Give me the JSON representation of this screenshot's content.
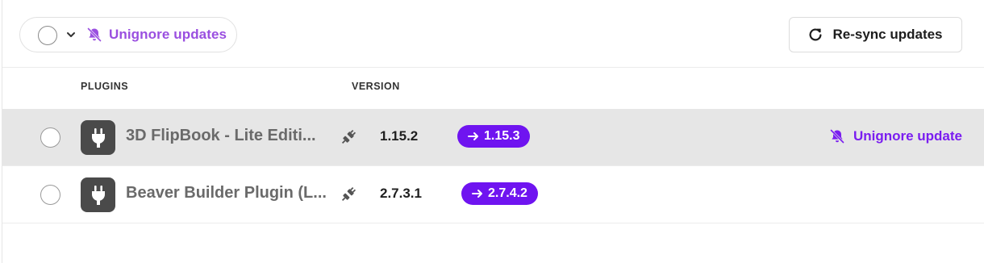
{
  "toolbar": {
    "ignore_label": "Unignore updates",
    "resync_label": "Re-sync updates"
  },
  "headers": {
    "plugins": "PLUGINS",
    "version": "VERSION"
  },
  "rows": [
    {
      "name": "3D FlipBook - Lite Editi...",
      "current_version": "1.15.2",
      "new_version": "1.15.3",
      "action_label": "Unignore update",
      "hovered": true
    },
    {
      "name": "Beaver Builder Plugin (L...",
      "current_version": "2.7.3.1",
      "new_version": "2.7.4.2",
      "action_label": "",
      "hovered": false
    }
  ],
  "colors": {
    "accent": "#6f14f0",
    "accent_light": "#9a4fe0",
    "hover_row": "#e6e6e6"
  },
  "icons": {
    "bulk_chevron": "chevron-down-icon",
    "ignore": "bell-slash-icon",
    "resync": "refresh-icon",
    "plugin": "plug-icon",
    "plugin_link": "plug-connected-icon",
    "arrow": "arrow-right-icon"
  }
}
